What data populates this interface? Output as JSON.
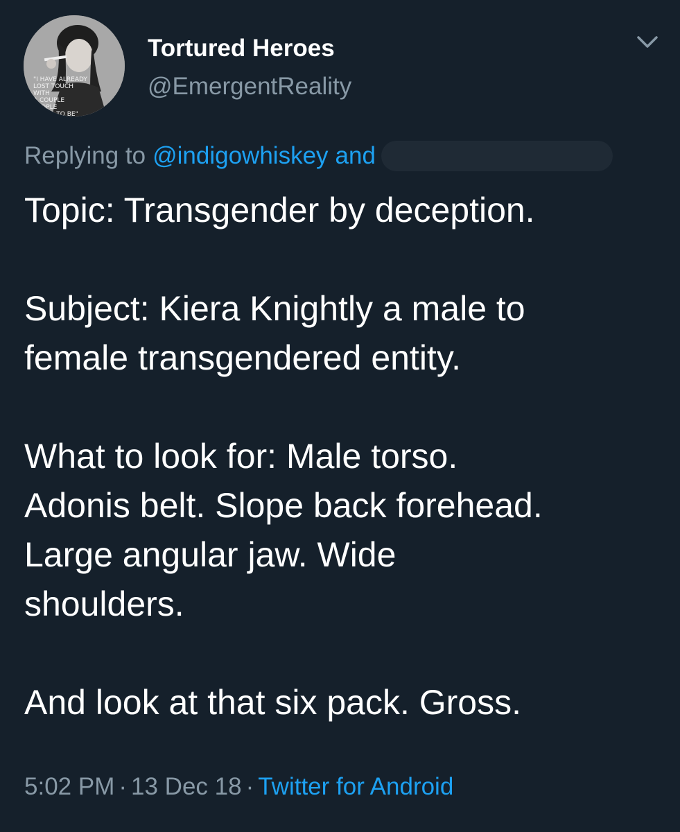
{
  "tweet": {
    "display_name": "Tortured Heroes",
    "handle": "@EmergentReality",
    "avatar_text": "\"I HAVE ALREADY LOST TOUCH WITH A COUPLE PEOPLE I USED TO BE\"",
    "reply": {
      "prefix": "Replying to",
      "mention": "@indigowhiskey",
      "conjunction": "and"
    },
    "body": {
      "line1": "Topic: Transgender by deception.",
      "line2": "Subject: Kiera Knightly a male to\nfemale transgendered entity.",
      "line3": "What to look for: Male torso.\nAdonis belt. Slope back forehead.\nLarge angular jaw. Wide\nshoulders.",
      "line4": "And look at that six pack. Gross."
    },
    "meta": {
      "time": "5:02 PM",
      "separator": "·",
      "date": "13 Dec 18",
      "source": "Twitter for Android"
    }
  },
  "icons": {
    "menu": "chevron-down-icon"
  },
  "colors": {
    "background": "#15202b",
    "text": "#ffffff",
    "secondary": "#8899a6",
    "link": "#1da1f2"
  }
}
